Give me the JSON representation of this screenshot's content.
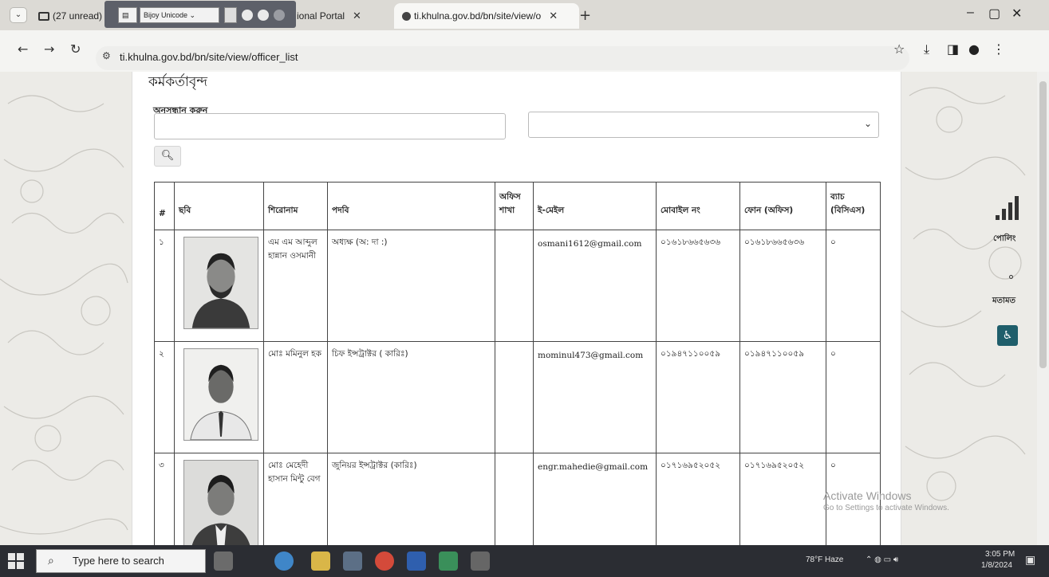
{
  "browser": {
    "tabs": [
      {
        "label": "(27 unread)"
      },
      {
        "label": "ional Portal"
      },
      {
        "label": "ti.khulna.gov.bd/bn/site/view/o"
      }
    ],
    "overlay_keyboard_label": "Bijoy Unicode",
    "url": "ti.khulna.gov.bd/bn/site/view/officer_list",
    "window_controls": {
      "minimize": "–",
      "maximize": "▢",
      "close": "✕"
    }
  },
  "page": {
    "title": "কর্মকর্তাবৃন্দ",
    "search_label": "অনুসন্ধান করুন",
    "search_input_value": "",
    "select_value": ""
  },
  "table": {
    "headers": [
      "#",
      "ছবি",
      "শিরোনাম",
      "পদবি",
      "অফিস শাখা",
      "ই-মেইল",
      "মোবাইল নং",
      "ফোন (অফিস)",
      "ব্যাচ (বিসিএস)"
    ],
    "rows": [
      {
        "serial": "১",
        "name": "এম এম আব্দুল হান্নান ওসমানী",
        "designation": "অধ্যক্ষ (অ: দা :)",
        "branch": "",
        "email": "osmani1612@gmail.com",
        "mobile": "০১৬১৮৬৬৫৬৩৬",
        "phone": "০১৬১৮৬৬৫৬৩৬",
        "batch": "০"
      },
      {
        "serial": "২",
        "name": "মোঃ মমিনুল হক",
        "designation": "চিফ ইন্সট্রাক্টর ( কারিঃ)",
        "branch": "",
        "email": "mominul473@gmail.com",
        "mobile": "০১৯৪৭১১০০৫৯",
        "phone": "০১৯৪৭১১০০৫৯",
        "batch": "০"
      },
      {
        "serial": "৩",
        "name": "মোঃ মেহেদী হাসান মিন্টু বেগ",
        "designation": "জুনিয়র ইন্সট্রাক্টর (কারিঃ)",
        "branch": "",
        "email": "engr.mahedie@gmail.com",
        "mobile": "০১৭১৬৯৫২০৫২",
        "phone": "০১৭১৬৯৫২০৫২",
        "batch": "০"
      }
    ]
  },
  "sidebar": {
    "poll_label": "পোলিং",
    "opinion_label": "মতামত"
  },
  "watermark": {
    "line1": "Activate Windows",
    "line2": "Go to Settings to activate Windows."
  },
  "taskbar": {
    "search_placeholder": "Type here to search",
    "weather": "78°F Haze",
    "time": "3:05 PM",
    "date": "1/8/2024"
  },
  "colors": {
    "a11y_button": "#1f5e6b",
    "taskbar": "#2b2d33",
    "table_border": "#444444"
  }
}
